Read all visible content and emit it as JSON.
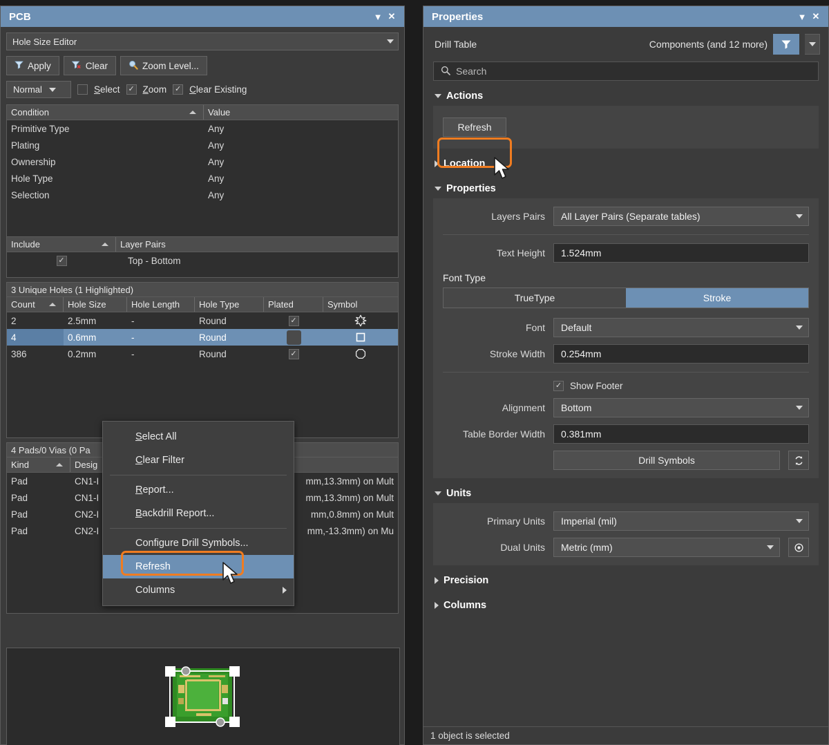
{
  "colors": {
    "accent_blue": "#6d90b4",
    "highlight_orange": "#f07c20",
    "panel_bg": "#3b3b3b",
    "table_bg": "#2f2f2f"
  },
  "pcb_panel": {
    "title": "PCB",
    "collapse_icon": "chevron-down-icon",
    "close_icon": "close-icon",
    "mode_combo": {
      "value": "Hole Size Editor"
    },
    "toolbar": [
      {
        "label": "Apply",
        "icon": "filter-icon"
      },
      {
        "label": "Clear",
        "icon": "filter-clear-icon"
      },
      {
        "label": "Zoom Level...",
        "icon": "magnifier-icon"
      }
    ],
    "options": {
      "mode_value": "Normal",
      "select": {
        "label": "Select",
        "checked": false
      },
      "zoom": {
        "label": "Zoom",
        "checked": true
      },
      "clear_existing": {
        "label": "Clear Existing",
        "checked": true
      }
    },
    "condition_table": {
      "headers": [
        "Condition",
        "Value"
      ],
      "rows": [
        {
          "condition": "Primitive Type",
          "value": "Any"
        },
        {
          "condition": "Plating",
          "value": "Any"
        },
        {
          "condition": "Ownership",
          "value": "Any"
        },
        {
          "condition": "Hole Type",
          "value": "Any"
        },
        {
          "condition": "Selection",
          "value": "Any"
        }
      ]
    },
    "layer_pairs_table": {
      "headers": [
        "Include",
        "Layer Pairs"
      ],
      "rows": [
        {
          "include": true,
          "pair": "Top - Bottom"
        }
      ]
    },
    "holes_table": {
      "caption": "3 Unique Holes (1 Highlighted)",
      "headers": [
        "Count",
        "Hole Size",
        "Hole Length",
        "Hole Type",
        "Plated",
        "Symbol"
      ],
      "rows": [
        {
          "count": "2",
          "hole_size": "2.5mm",
          "hole_length": "-",
          "hole_type": "Round",
          "plated": true,
          "symbol": "star-symbol",
          "selected": false
        },
        {
          "count": "4",
          "hole_size": "0.6mm",
          "hole_length": "-",
          "hole_type": "Round",
          "plated": false,
          "symbol": "square-symbol",
          "selected": true
        },
        {
          "count": "386",
          "hole_size": "0.2mm",
          "hole_length": "-",
          "hole_type": "Round",
          "plated": true,
          "symbol": "octagon-symbol",
          "selected": false
        }
      ]
    },
    "pads_table": {
      "caption": "4 Pads/0 Vias (0 Pa",
      "headers": [
        "Kind",
        "Desig"
      ],
      "rows": [
        {
          "kind": "Pad",
          "designator": "CN1-I",
          "location": "mm,13.3mm) on Mult"
        },
        {
          "kind": "Pad",
          "designator": "CN1-I",
          "location": "mm,13.3mm) on Mult"
        },
        {
          "kind": "Pad",
          "designator": "CN2-I",
          "location": "mm,0.8mm) on Mult"
        },
        {
          "kind": "Pad",
          "designator": "CN2-I",
          "location": "mm,-13.3mm) on Mu"
        }
      ]
    },
    "context_menu": {
      "items": [
        {
          "label": "Select All",
          "accel": "S",
          "type": "item"
        },
        {
          "label": "Clear Filter",
          "accel": "C",
          "type": "item"
        },
        {
          "type": "separator"
        },
        {
          "label": "Report...",
          "accel": "R",
          "type": "item"
        },
        {
          "label": "Backdrill Report...",
          "accel": "B",
          "type": "item"
        },
        {
          "type": "separator"
        },
        {
          "label": "Configure Drill Symbols...",
          "type": "item"
        },
        {
          "label": "Refresh",
          "type": "item",
          "highlighted": true
        },
        {
          "label": "Columns",
          "type": "submenu"
        }
      ]
    }
  },
  "properties_panel": {
    "title": "Properties",
    "collapse_icon": "chevron-down-icon",
    "close_icon": "close-icon",
    "object_type": "Drill Table",
    "object_scope": "Components (and 12 more)",
    "filter_icon": "filter-icon",
    "filter_caret_icon": "chevron-down-icon",
    "search": {
      "placeholder": "Search",
      "value": "",
      "icon": "search-icon"
    },
    "sections": {
      "actions": {
        "label": "Actions",
        "expanded": true,
        "refresh_label": "Refresh"
      },
      "location": {
        "label": "Location",
        "expanded": false
      },
      "properties": {
        "label": "Properties",
        "expanded": true
      },
      "units": {
        "label": "Units",
        "expanded": true
      },
      "precision": {
        "label": "Precision",
        "expanded": false
      },
      "columns": {
        "label": "Columns",
        "expanded": false
      }
    },
    "fields": {
      "layers_pairs": {
        "label": "Layers Pairs",
        "value": "All Layer Pairs (Separate tables)"
      },
      "text_height": {
        "label": "Text Height",
        "value": "1.524mm"
      },
      "font_type": {
        "label": "Font Type",
        "options": [
          "TrueType",
          "Stroke"
        ],
        "selected": "Stroke"
      },
      "font": {
        "label": "Font",
        "value": "Default"
      },
      "stroke_width": {
        "label": "Stroke Width",
        "value": "0.254mm"
      },
      "show_footer": {
        "label": "Show Footer",
        "checked": true
      },
      "alignment": {
        "label": "Alignment",
        "value": "Bottom"
      },
      "table_border_width": {
        "label": "Table Border Width",
        "value": "0.381mm"
      },
      "drill_symbols": {
        "label": "Drill Symbols",
        "swap_icon": "swap-arrows-icon"
      },
      "primary_units": {
        "label": "Primary Units",
        "value": "Imperial (mil)"
      },
      "dual_units": {
        "label": "Dual Units",
        "value": "Metric (mm)",
        "eye_icon": "eye-icon"
      }
    },
    "status": "1 object is selected"
  }
}
